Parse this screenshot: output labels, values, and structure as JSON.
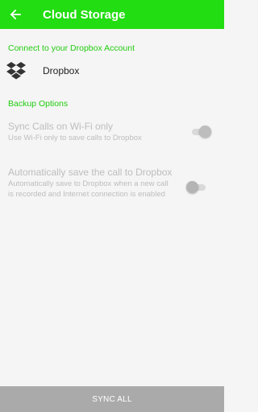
{
  "colors": {
    "app_bar": "#22dd11",
    "accent": "#22cc11",
    "background": "#f5f5f5",
    "sync_bar": "#aaaaaa"
  },
  "app_bar": {
    "title": "Cloud Storage",
    "back_icon": "arrow-left-icon"
  },
  "dropbox_section": {
    "header": "Connect to your Dropbox Account",
    "account_label": "Dropbox",
    "icon": "dropbox-icon"
  },
  "backup_section": {
    "header": "Backup Options",
    "wifi_pref": {
      "title": "Sync Calls on Wi-Fi only",
      "summary": "Use Wi-Fi only to save calls to Dropbox",
      "enabled": true
    },
    "auto_save_pref": {
      "title": "Automatically save the call to Dropbox",
      "summary": "Automatically save to Dropbox when a new call is recorded and Internet connection is enabled",
      "enabled": false
    }
  },
  "footer": {
    "sync_all_label": "SYNC ALL"
  }
}
